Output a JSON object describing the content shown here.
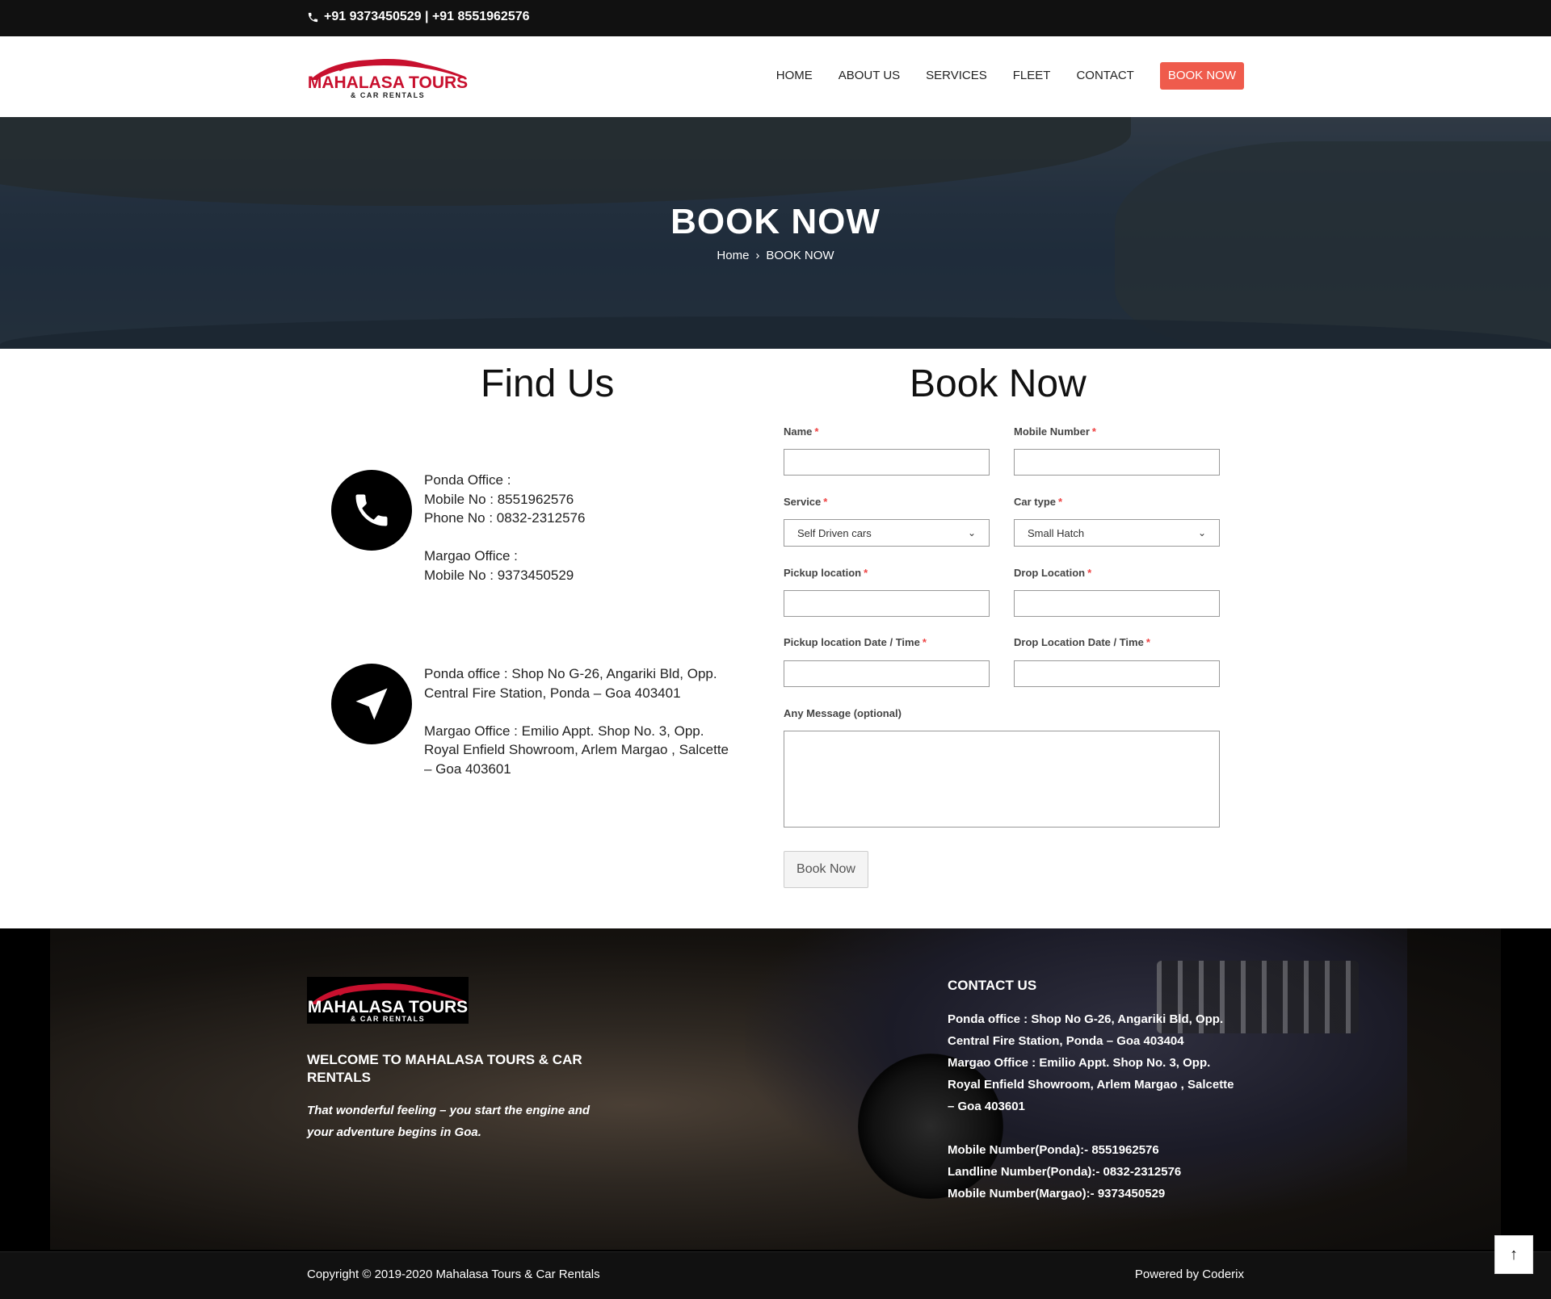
{
  "topbar": {
    "phone_text": "+91 9373450529 | +91 8551962576"
  },
  "brand": {
    "name_line1": "MAHALASA TOURS",
    "name_line2": "& CAR RENTALS",
    "brand_color": "#c8102e"
  },
  "nav": {
    "items": [
      {
        "label": "HOME"
      },
      {
        "label": "ABOUT US"
      },
      {
        "label": "SERVICES"
      },
      {
        "label": "FLEET"
      },
      {
        "label": "CONTACT"
      }
    ],
    "cta": "BOOK NOW",
    "cta_color": "#ef5b4c"
  },
  "hero": {
    "title": "BOOK NOW",
    "breadcrumb_home": "Home",
    "breadcrumb_sep": "›",
    "breadcrumb_current": "BOOK NOW"
  },
  "find_us": {
    "title": "Find Us",
    "phone_block": "Ponda Office :\nMobile No : 8551962576\nPhone No : 0832-2312576\n\nMargao Office :\nMobile No : 9373450529",
    "address_block": "Ponda office : Shop No G-26, Angariki Bld, Opp.\nCentral Fire Station, Ponda – Goa 403401\n\nMargao Office : Emilio Appt. Shop No. 3, Opp.\nRoyal Enfield Showroom, Arlem Margao , Salcette\n– Goa 403601"
  },
  "form": {
    "title": "Book Now",
    "required_mark": "*",
    "name_label": "Name",
    "mobile_label": "Mobile Number",
    "service_label": "Service",
    "service_value": "Self Driven cars",
    "car_type_label": "Car type",
    "car_type_value": "Small Hatch",
    "pickup_label": "Pickup location",
    "drop_label": "Drop Location",
    "pickup_dt_label": "Pickup location Date / Time",
    "drop_dt_label": "Drop Location Date / Time",
    "message_label": "Any Message (optional)",
    "submit_label": "Book Now"
  },
  "footer": {
    "welcome": "WELCOME TO MAHALASA TOURS & CAR RENTALS",
    "tagline": "That wonderful feeling – you start the engine and your adventure begins in Goa.",
    "contact_title": "CONTACT US",
    "contact_body": "Ponda office : Shop No G-26, Angariki Bld, Opp.\nCentral Fire Station, Ponda – Goa 403404\nMargao Office : Emilio Appt. Shop No. 3, Opp.\nRoyal Enfield Showroom, Arlem Margao , Salcette\n– Goa 403601\n\nMobile Number(Ponda):- 8551962576\nLandline Number(Ponda):- 0832-2312576\nMobile Number(Margao):- 9373450529",
    "copyright": "Copyright © 2019-2020 Mahalasa Tours & Car Rentals",
    "powered": "Powered by Coderix",
    "to_top_icon": "arrow-up-icon"
  }
}
